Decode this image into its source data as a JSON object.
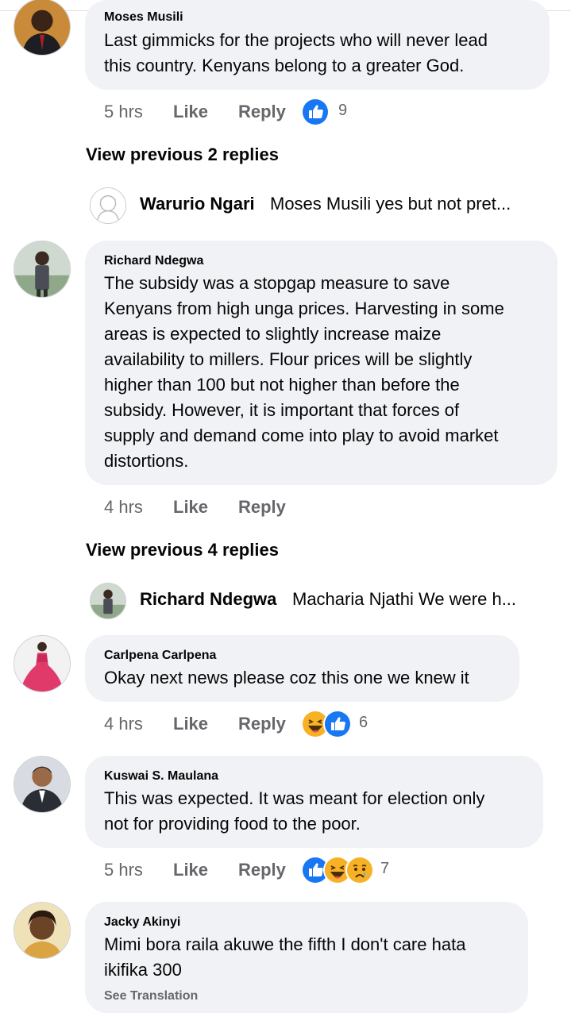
{
  "comments": [
    {
      "author": "Moses Musili",
      "lines": [
        "Last gimmicks for the projects who will never lead",
        "this country. Kenyans belong to a greater God."
      ],
      "time": "5 hrs",
      "like": "Like",
      "reply": "Reply",
      "reactions": [
        "like-icon"
      ],
      "reaction_count": "9"
    },
    {
      "author": "Richard Ndegwa",
      "lines": [
        "The subsidy was a stopgap measure to save",
        "Kenyans from high unga prices. Harvesting in some",
        "areas is expected to slightly increase maize",
        "availability to millers. Flour prices will be slightly",
        "higher than 100 but not higher than before the",
        "subsidy. However, it is important that forces of",
        "supply and demand come into play to avoid market",
        "distortions."
      ],
      "time": "4 hrs",
      "like": "Like",
      "reply": "Reply"
    },
    {
      "author": "Carlpena Carlpena",
      "lines": [
        "Okay next news please coz this one we knew it"
      ],
      "time": "4 hrs",
      "like": "Like",
      "reply": "Reply",
      "reactions": [
        "haha-icon",
        "like-icon"
      ],
      "reaction_count": "6"
    },
    {
      "author": "Kuswai S. Maulana",
      "lines": [
        "This was expected. It was meant for election only",
        "not for providing food to the poor."
      ],
      "time": "5 hrs",
      "like": "Like",
      "reply": "Reply",
      "reactions": [
        "like-icon",
        "haha-icon",
        "sad-icon"
      ],
      "reaction_count": "7"
    },
    {
      "author": "Jacky Akinyi",
      "lines": [
        "Mimi bora raila akuwe the fifth  I don't care hata",
        "ikifika 300"
      ],
      "see_translation": "See Translation"
    }
  ],
  "view_previous": [
    "View previous 2 replies",
    "View previous 4 replies"
  ],
  "reply_previews": [
    {
      "author": "Warurio Ngari",
      "text": "Moses Musili yes but not pret..."
    },
    {
      "author": "Richard Ndegwa",
      "text": "Macharia Njathi We were h..."
    }
  ],
  "colors": {
    "like_blue": "#1877f2",
    "emoji_yellow": "#f7b125",
    "bubble": "#f0f2f5",
    "meta_gray": "#65676b"
  }
}
